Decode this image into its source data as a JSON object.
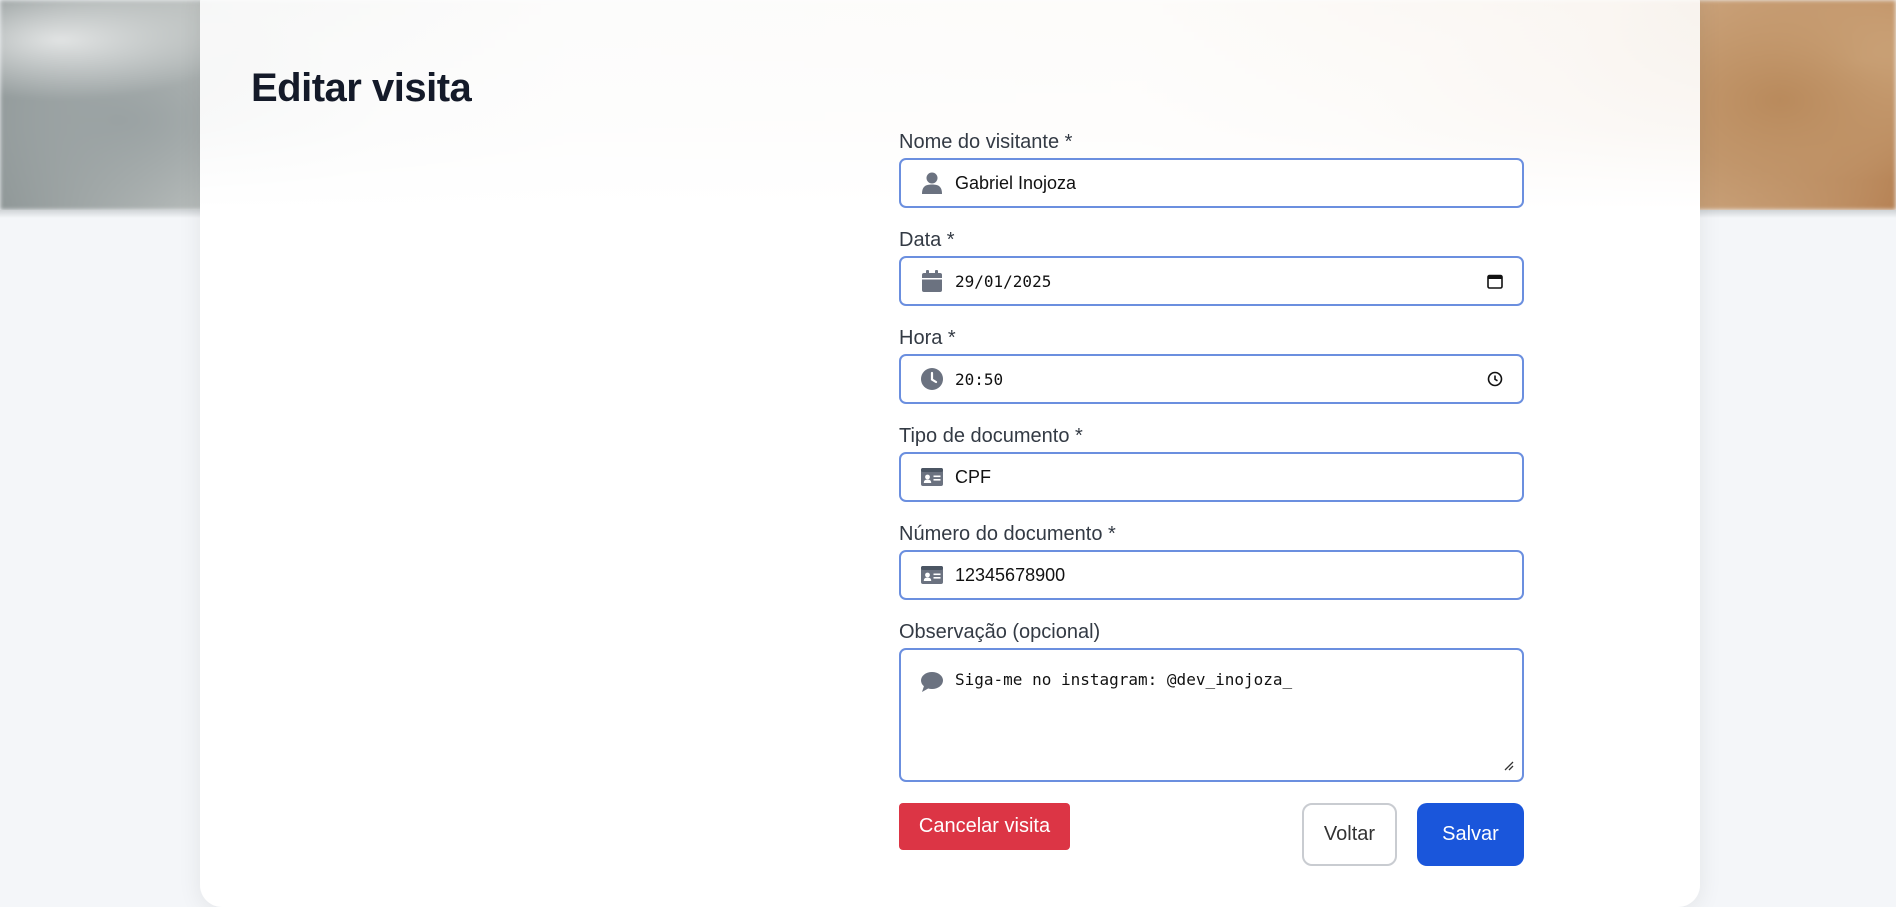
{
  "page": {
    "title": "Editar visita"
  },
  "form": {
    "visitor_name": {
      "label": "Nome do visitante *",
      "value": "Gabriel Inojoza",
      "icon": "user-icon"
    },
    "date": {
      "label": "Data *",
      "value": "29/01/2025",
      "icon": "calendar-icon"
    },
    "time": {
      "label": "Hora *",
      "value": "20:50",
      "icon": "clock-icon"
    },
    "document_type": {
      "label": "Tipo de documento *",
      "value": "CPF",
      "icon": "id-card-icon"
    },
    "document_number": {
      "label": "Número do documento *",
      "value": "12345678900",
      "icon": "id-card-icon"
    },
    "observation": {
      "label": "Observação (opcional)",
      "value": "Siga-me no instagram: @dev_inojoza_",
      "icon": "comment-icon"
    }
  },
  "actions": {
    "cancel_label": "Cancelar visita",
    "back_label": "Voltar",
    "save_label": "Salvar"
  },
  "colors": {
    "input_border": "#6b8fdf",
    "danger": "#dc3545",
    "primary": "#1a56db",
    "icon": "#6b7280"
  }
}
